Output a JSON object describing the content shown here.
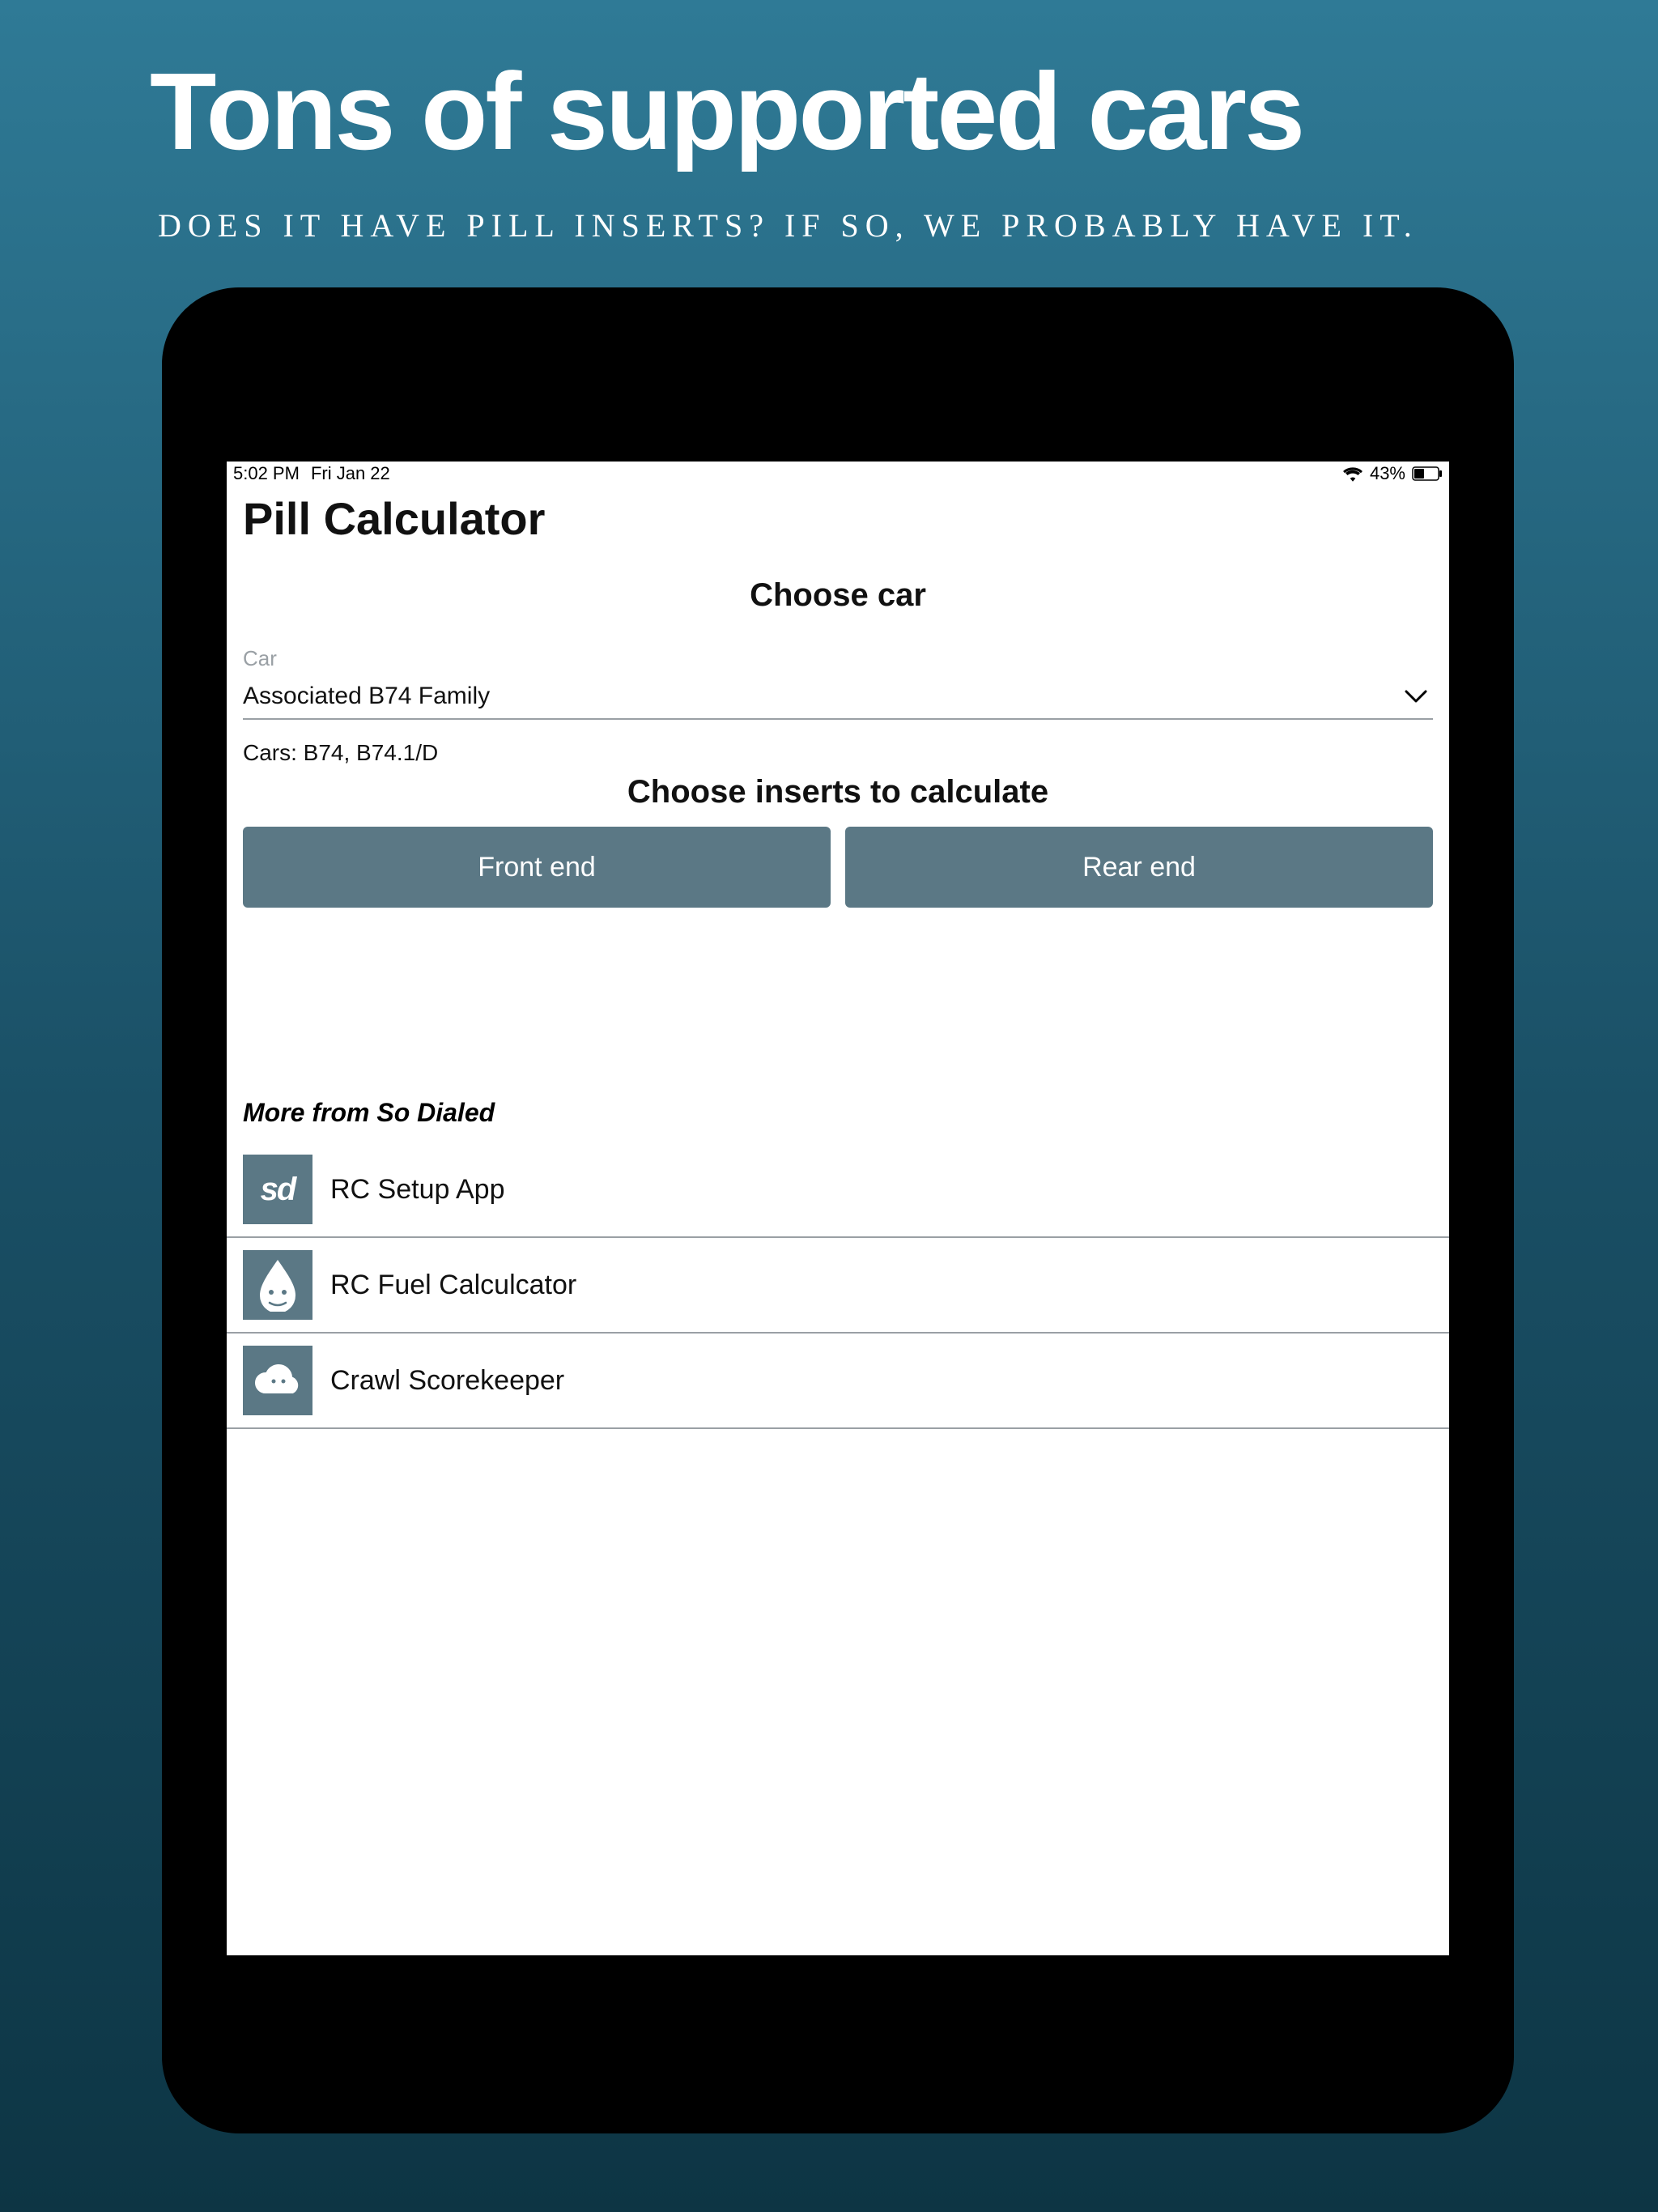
{
  "promo": {
    "headline": "Tons of supported cars",
    "subhead": "Does it have pill inserts?  If so, we probably have it."
  },
  "status": {
    "time": "5:02 PM",
    "date": "Fri Jan 22",
    "battery_pct": "43%"
  },
  "app": {
    "title": "Pill Calculator",
    "choose_car_heading": "Choose car",
    "car_field_label": "Car",
    "selected_car": "Associated B74 Family",
    "cars_detail": "Cars:  B74, B74.1/D",
    "choose_inserts_heading": "Choose inserts to calculate",
    "buttons": {
      "front": "Front end",
      "rear": "Rear end"
    },
    "more_heading": "More from So Dialed",
    "more_apps": [
      {
        "label": "RC Setup App",
        "icon": "sd"
      },
      {
        "label": "RC Fuel Calculcator",
        "icon": "droplet"
      },
      {
        "label": "Crawl Scorekeeper",
        "icon": "cloud"
      }
    ]
  }
}
